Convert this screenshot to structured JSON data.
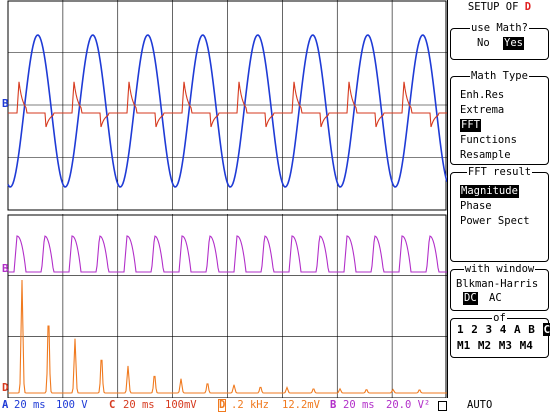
{
  "menu": {
    "title": "SETUP OF",
    "title_channel": "D",
    "use_math": {
      "title": "use Math?",
      "options": [
        "No",
        "Yes"
      ],
      "selected": "Yes"
    },
    "math_type": {
      "title": "Math Type",
      "options": [
        "Enh.Res",
        "Extrema",
        "FFT",
        "Functions",
        "Resample"
      ],
      "selected": "FFT"
    },
    "fft_result": {
      "title": "FFT result",
      "options": [
        "Magnitude",
        "Phase",
        "Power Spect"
      ],
      "selected": "Magnitude"
    },
    "window": {
      "title": "with window",
      "name": "Blkman-Harris",
      "options": [
        "DC",
        "AC"
      ],
      "selected": "DC"
    },
    "of": {
      "title": "of",
      "row1": [
        "1",
        "2",
        "3",
        "4",
        "A",
        "B",
        "C"
      ],
      "row2": [
        "M1",
        "M2",
        "M3",
        "M4"
      ],
      "selected": "C"
    }
  },
  "status": {
    "a_label": "A",
    "a_time": "20 ms",
    "a_scale": "100 V",
    "c_label": "C",
    "c_time": "20 ms",
    "c_scale": "100mV",
    "d_label": "D",
    "d_freq": ".2 kHz",
    "d_scale": "12.2mV",
    "b_label": "B",
    "b_time": "20 ms",
    "b_scale": "20.0 V²",
    "mode": "AUTO"
  },
  "markers": {
    "top": "B",
    "middle": "B",
    "bottom": "D"
  },
  "colors": {
    "trace_a": "#1f3bd6",
    "trace_c": "#d63a1f",
    "trace_b": "#b22fc9",
    "trace_d": "#f07a1f",
    "grid": "#000000"
  }
}
